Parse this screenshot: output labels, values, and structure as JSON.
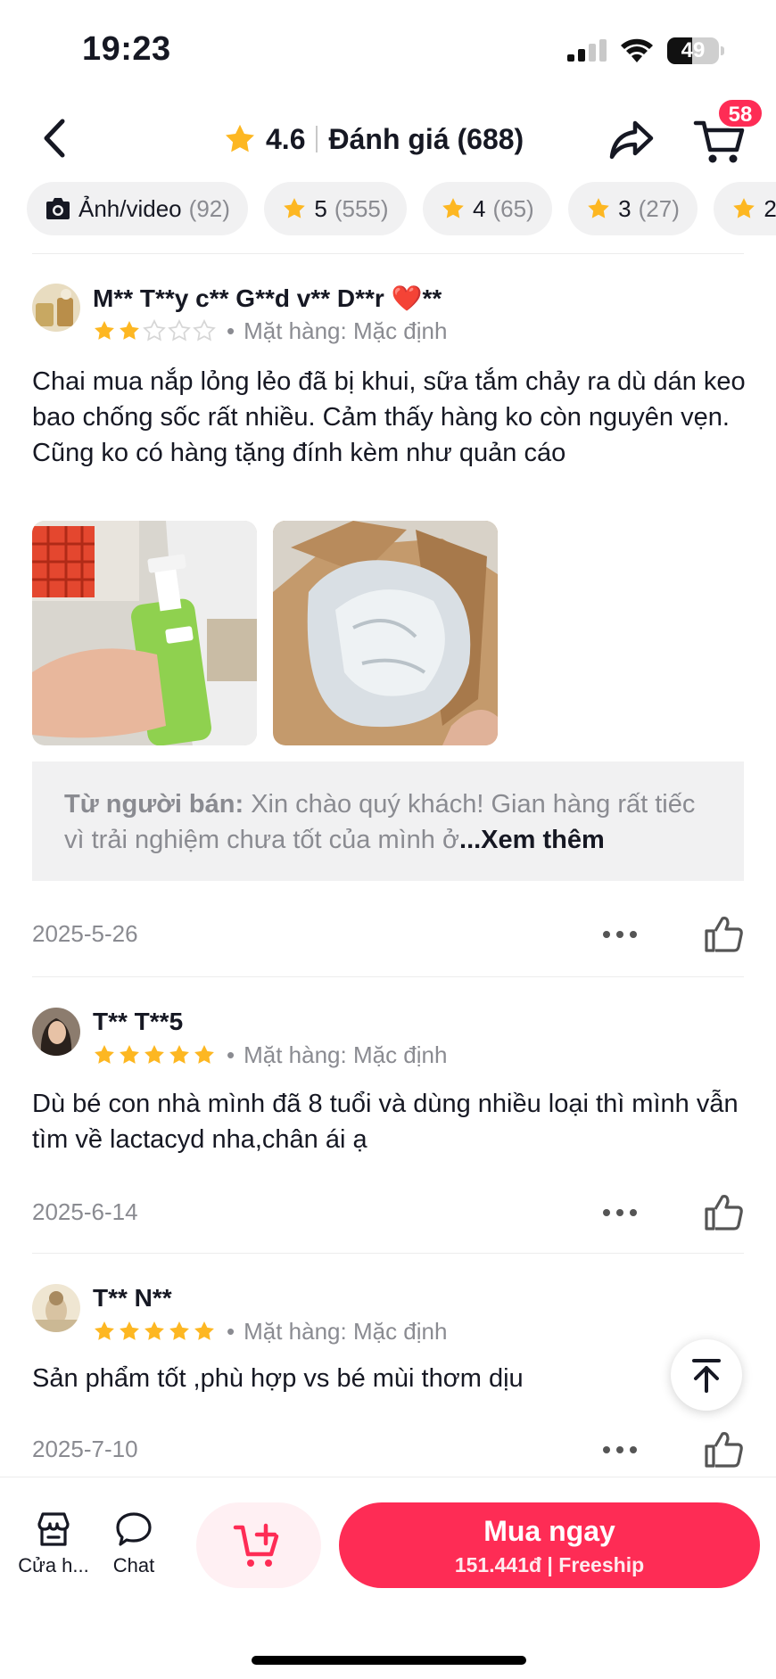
{
  "status_bar": {
    "time": "19:23",
    "battery": "49",
    "battery_level": 0.49
  },
  "header": {
    "rating": "4.6",
    "title": "Đánh giá (688)",
    "cart_count": "58"
  },
  "filters": [
    {
      "label": "Ảnh/video",
      "count": "(92)",
      "icon": "camera-icon"
    },
    {
      "label": "5",
      "count": "(555)",
      "icon": "star-icon"
    },
    {
      "label": "4",
      "count": "(65)",
      "icon": "star-icon"
    },
    {
      "label": "3",
      "count": "(27)",
      "icon": "star-icon"
    },
    {
      "label": "2",
      "count": "",
      "icon": "star-icon"
    }
  ],
  "reviews": [
    {
      "name": "M** T**y c** G**d v** D**r ❤️**",
      "rating": 2,
      "dot": "•",
      "variant": "Mặt hàng: Mặc định",
      "text": "Chai mua nắp lỏng lẻo đã bị khui, sữa tắm chảy ra dù dán keo bao chống sốc rất nhiều. Cảm thấy hàng ko còn nguyên vẹn. Cũng ko có hàng tặng đính kèm như quản cáo",
      "seller_label": "Từ người bán:",
      "seller_reply": " Xin chào quý khách! Gian hàng rất tiếc vì trải nghiệm chưa tốt của mình ở",
      "see_more": "...Xem thêm",
      "date": "2025-5-26"
    },
    {
      "name": "T** T**5",
      "rating": 5,
      "dot": "•",
      "variant": "Mặt hàng: Mặc định",
      "text": "Dù bé con nhà mình đã 8 tuổi và dùng nhiều loại thì mình vẫn tìm về lactacyd nha,chân ái ạ",
      "date": "2025-6-14"
    },
    {
      "name": "T** N**",
      "rating": 5,
      "dot": "•",
      "variant": "Mặt hàng: Mặc định",
      "text": "Sản phẩm tốt ,phù hợp vs bé mùi thơm dịu",
      "date": "2025-7-10"
    }
  ],
  "bottom_bar": {
    "shop_label": "Cửa h...",
    "chat_label": "Chat",
    "buy_label": "Mua ngay",
    "price": "151.441đ",
    "shipping": "Freeship"
  },
  "colors": {
    "accent": "#fe2c55",
    "star": "#fdb722",
    "muted": "#8a8b91",
    "chip_bg": "#f1f1f2"
  }
}
